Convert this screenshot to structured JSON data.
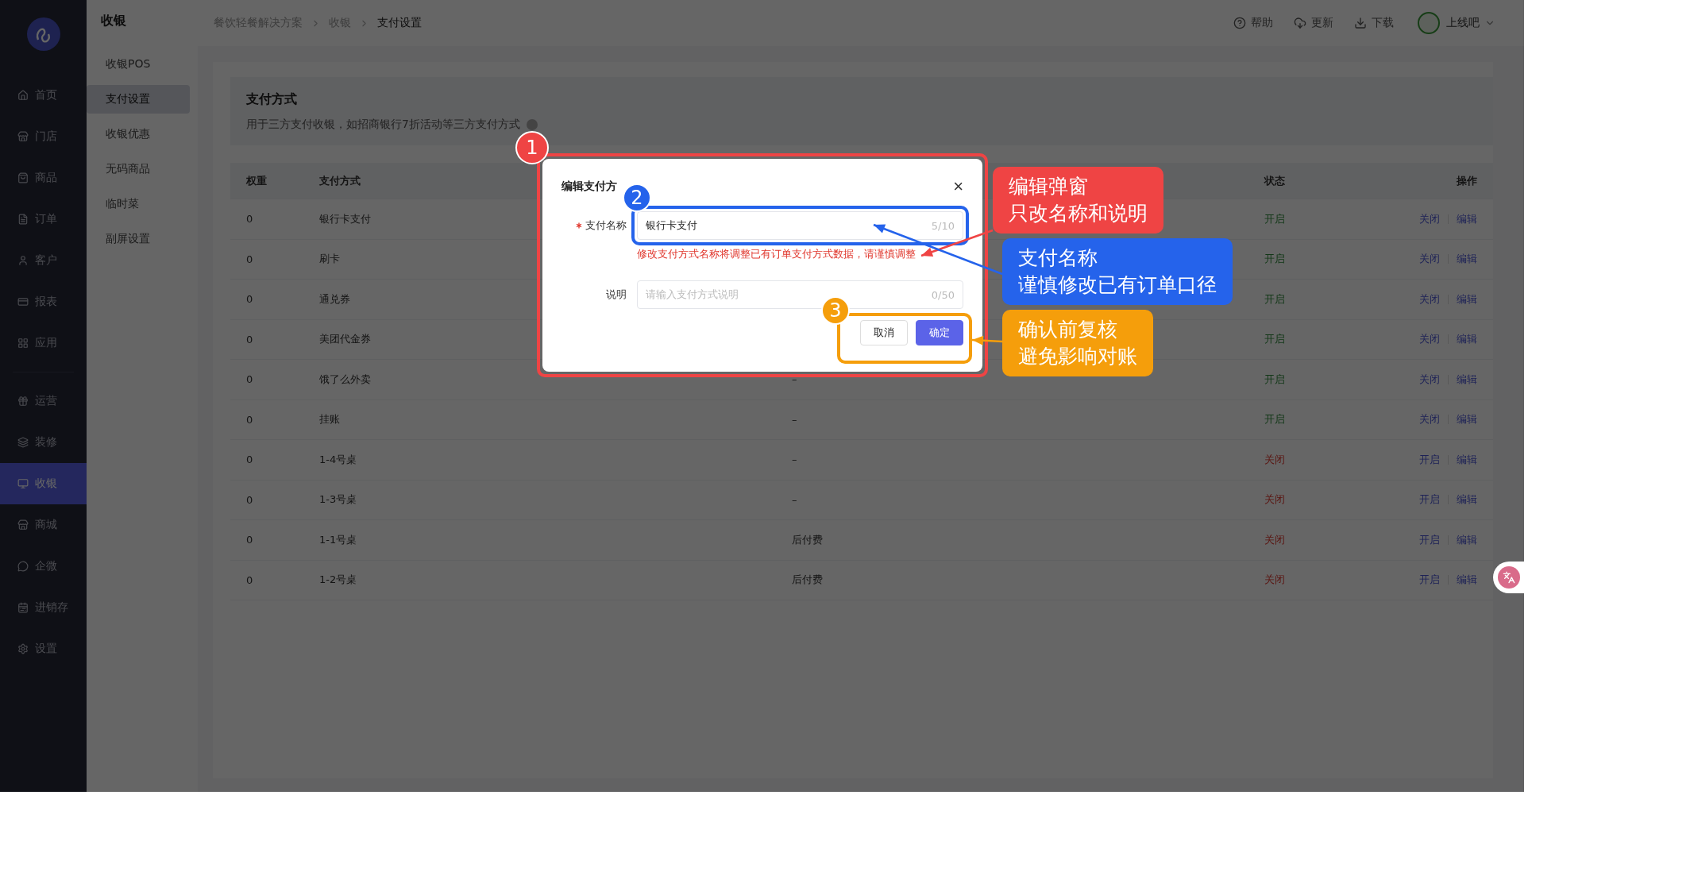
{
  "sidebar": {
    "primary_items": [
      {
        "label": "首页",
        "selected": false
      },
      {
        "label": "门店",
        "selected": false
      },
      {
        "label": "商品",
        "selected": false
      },
      {
        "label": "订单",
        "selected": false
      },
      {
        "label": "客户",
        "selected": false
      },
      {
        "label": "报表",
        "selected": false
      },
      {
        "label": "应用",
        "selected": false
      }
    ],
    "secondary_items": [
      {
        "label": "运营",
        "selected": false
      },
      {
        "label": "装修",
        "selected": false
      },
      {
        "label": "收银",
        "selected": true
      },
      {
        "label": "商城",
        "selected": false
      },
      {
        "label": "企微",
        "selected": false
      },
      {
        "label": "进销存",
        "selected": false
      },
      {
        "label": "设置",
        "selected": false
      }
    ]
  },
  "submenu": {
    "title": "收银",
    "items": [
      {
        "label": "收银POS",
        "selected": false
      },
      {
        "label": "支付设置",
        "selected": true
      },
      {
        "label": "收银优惠",
        "selected": false
      },
      {
        "label": "无码商品",
        "selected": false
      },
      {
        "label": "临时菜",
        "selected": false
      },
      {
        "label": "副屏设置",
        "selected": false
      }
    ]
  },
  "breadcrumb": [
    "餐饮轻餐解决方案",
    "收银",
    "支付设置"
  ],
  "header_tools": [
    {
      "label": "帮助"
    },
    {
      "label": "更新"
    },
    {
      "label": "下载"
    }
  ],
  "user": {
    "name": "上线吧"
  },
  "section": {
    "title": "支付方式",
    "description": "用于三方支付收银，如招商银行7折活动等三方支付方式"
  },
  "table": {
    "columns": [
      "权重",
      "支付方式",
      "状态",
      "操作"
    ],
    "rows": [
      {
        "weight": "0",
        "method": "银行卡支付",
        "status": "开启",
        "on": true,
        "toggle": "关闭",
        "edit": "编辑"
      },
      {
        "weight": "0",
        "method": "刷卡",
        "status": "开启",
        "on": true,
        "toggle": "关闭",
        "edit": "编辑"
      },
      {
        "weight": "0",
        "method": "通兑券",
        "status": "开启",
        "on": true,
        "toggle": "关闭",
        "edit": "编辑"
      },
      {
        "weight": "0",
        "method": "美团代金券",
        "status": "开启",
        "on": true,
        "toggle": "关闭",
        "edit": "编辑"
      },
      {
        "weight": "0",
        "method": "饿了么外卖",
        "note": "–",
        "status": "开启",
        "on": true,
        "toggle": "关闭",
        "edit": "编辑"
      },
      {
        "weight": "0",
        "method": "挂账",
        "note": "–",
        "status": "开启",
        "on": true,
        "toggle": "关闭",
        "edit": "编辑"
      },
      {
        "weight": "0",
        "method": "1-4号桌",
        "note": "–",
        "status": "关闭",
        "on": false,
        "toggle": "开启",
        "edit": "编辑"
      },
      {
        "weight": "0",
        "method": "1-3号桌",
        "note": "–",
        "status": "关闭",
        "on": false,
        "toggle": "开启",
        "edit": "编辑"
      },
      {
        "weight": "0",
        "method": "1-1号桌",
        "note": "后付费",
        "status": "关闭",
        "on": false,
        "toggle": "开启",
        "edit": "编辑"
      },
      {
        "weight": "0",
        "method": "1-2号桌",
        "note": "后付费",
        "status": "关闭",
        "on": false,
        "toggle": "开启",
        "edit": "编辑"
      }
    ]
  },
  "dialog": {
    "title": "编辑支付方",
    "close": "×",
    "fields": [
      {
        "label": "支付名称",
        "required": true,
        "value": "银行卡支付",
        "counter": "5/10",
        "hint": "修改支付方式名称将调整已有订单支付方式数据，请谨慎调整"
      },
      {
        "label": "说明",
        "required": false,
        "placeholder": "请输入支付方式说明",
        "counter": "0/50"
      }
    ],
    "buttons": [
      {
        "label": "取消",
        "kind": "secondary"
      },
      {
        "label": "确定",
        "kind": "primary"
      }
    ]
  },
  "annotations": {
    "badges": [
      {
        "label": "1",
        "color": "#ef4444"
      },
      {
        "label": "2",
        "color": "#2563eb"
      },
      {
        "label": "3",
        "color": "#f59e0b"
      }
    ],
    "callouts": [
      {
        "lines": [
          "编辑弹窗",
          "只改名称和说明"
        ],
        "color": "#ef4444"
      },
      {
        "lines": [
          "支付名称",
          "谨慎修改已有订单口径"
        ],
        "color": "#2563eb"
      },
      {
        "lines": [
          "确认前复核",
          "避免影响对账"
        ],
        "color": "#f59e0b"
      }
    ]
  }
}
